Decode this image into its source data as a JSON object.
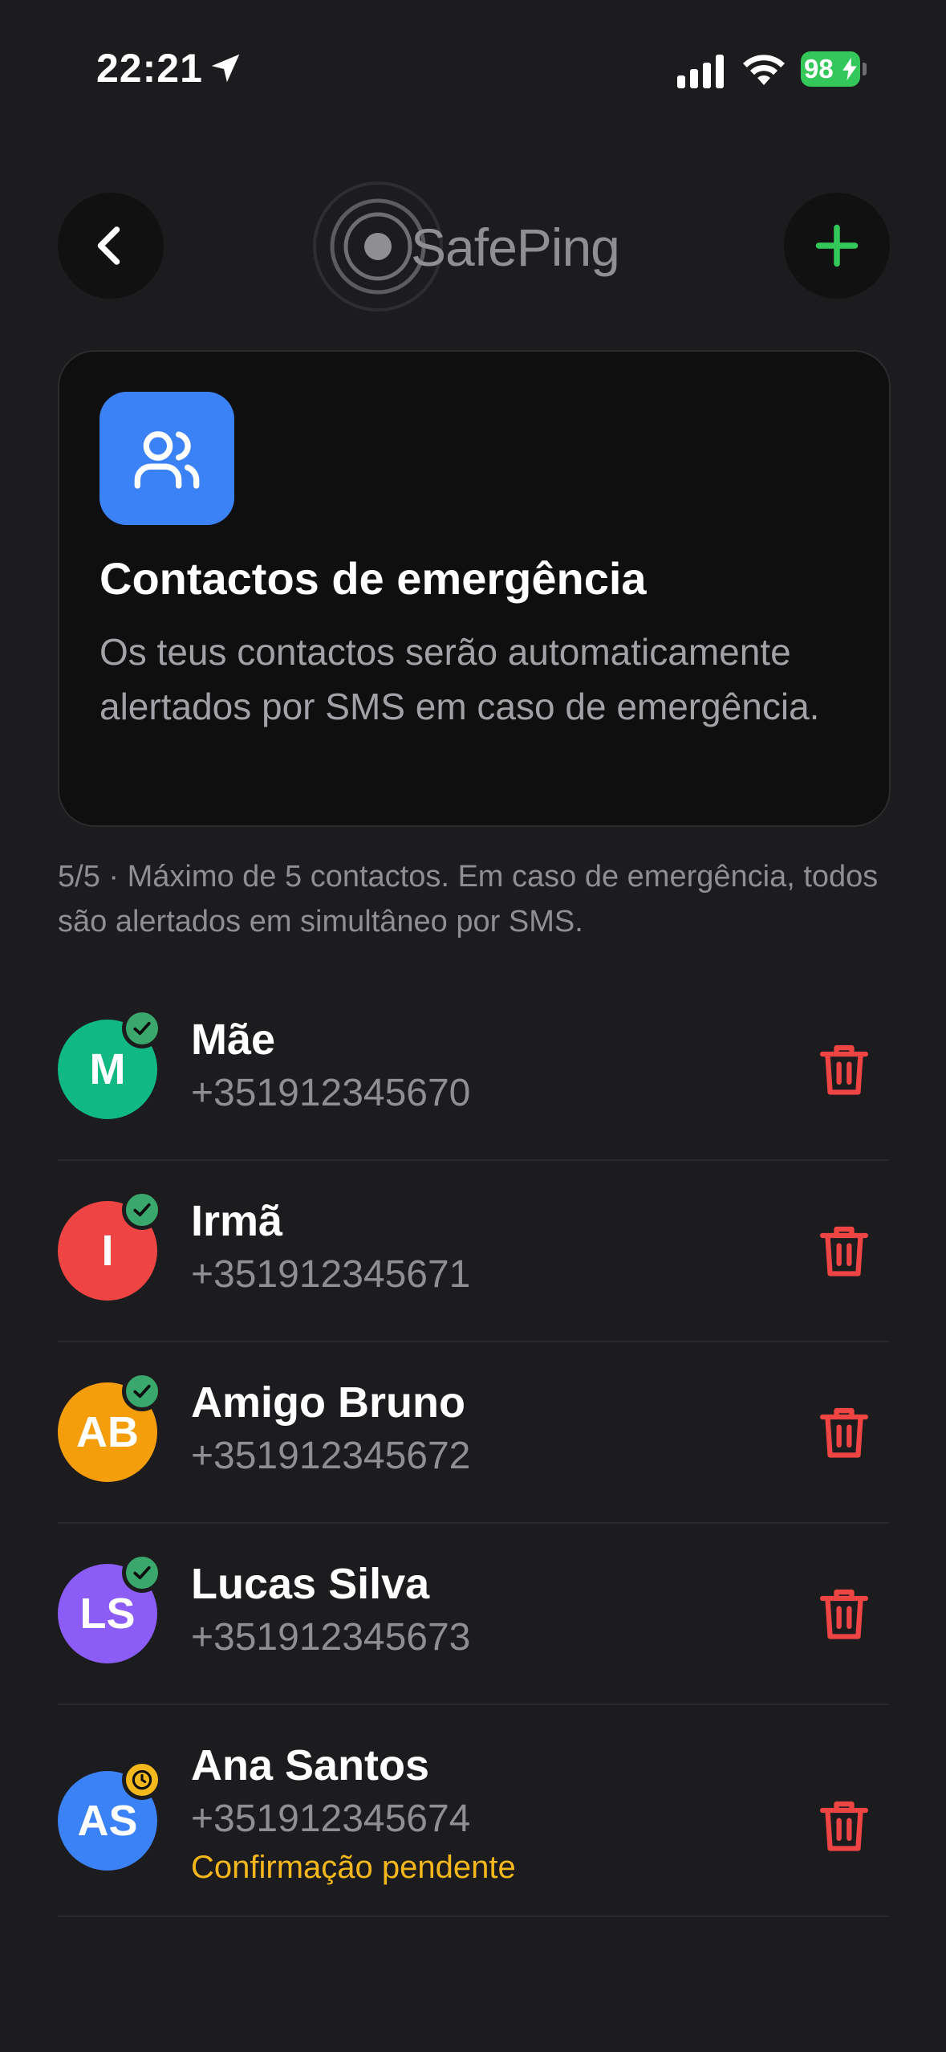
{
  "status_bar": {
    "time": "22:21",
    "battery": "98"
  },
  "header": {
    "logo_text": "SafePing",
    "back_icon": "chevron-left-icon",
    "add_icon": "plus-icon"
  },
  "info_card": {
    "icon": "users-icon",
    "title": "Contactos de emergência",
    "description": "Os teus contactos serão automaticamente alertados por SMS em caso de emergência."
  },
  "limit_note": "5/5 · Máximo de 5 contactos. Em caso de emergência, todos são alertados em simultâneo por SMS.",
  "contacts": [
    {
      "initials": "M",
      "name": "Mãe",
      "phone": "+351912345670",
      "color": "#10b981",
      "status": "confirmed"
    },
    {
      "initials": "I",
      "name": "Irmã",
      "phone": "+351912345671",
      "color": "#ef4444",
      "status": "confirmed"
    },
    {
      "initials": "AB",
      "name": "Amigo Bruno",
      "phone": "+351912345672",
      "color": "#f59e0b",
      "status": "confirmed"
    },
    {
      "initials": "LS",
      "name": "Lucas Silva",
      "phone": "+351912345673",
      "color": "#8b5cf6",
      "status": "confirmed"
    },
    {
      "initials": "AS",
      "name": "Ana Santos",
      "phone": "+351912345674",
      "color": "#3b82f6",
      "status": "pending",
      "pending_label": "Confirmação pendente"
    }
  ],
  "colors": {
    "background": "#1c1c1e",
    "accent_green": "#34c759",
    "delete_red": "#ef4444",
    "pending_yellow": "#f5b81c",
    "confirmed_badge": "#3aa76d"
  }
}
